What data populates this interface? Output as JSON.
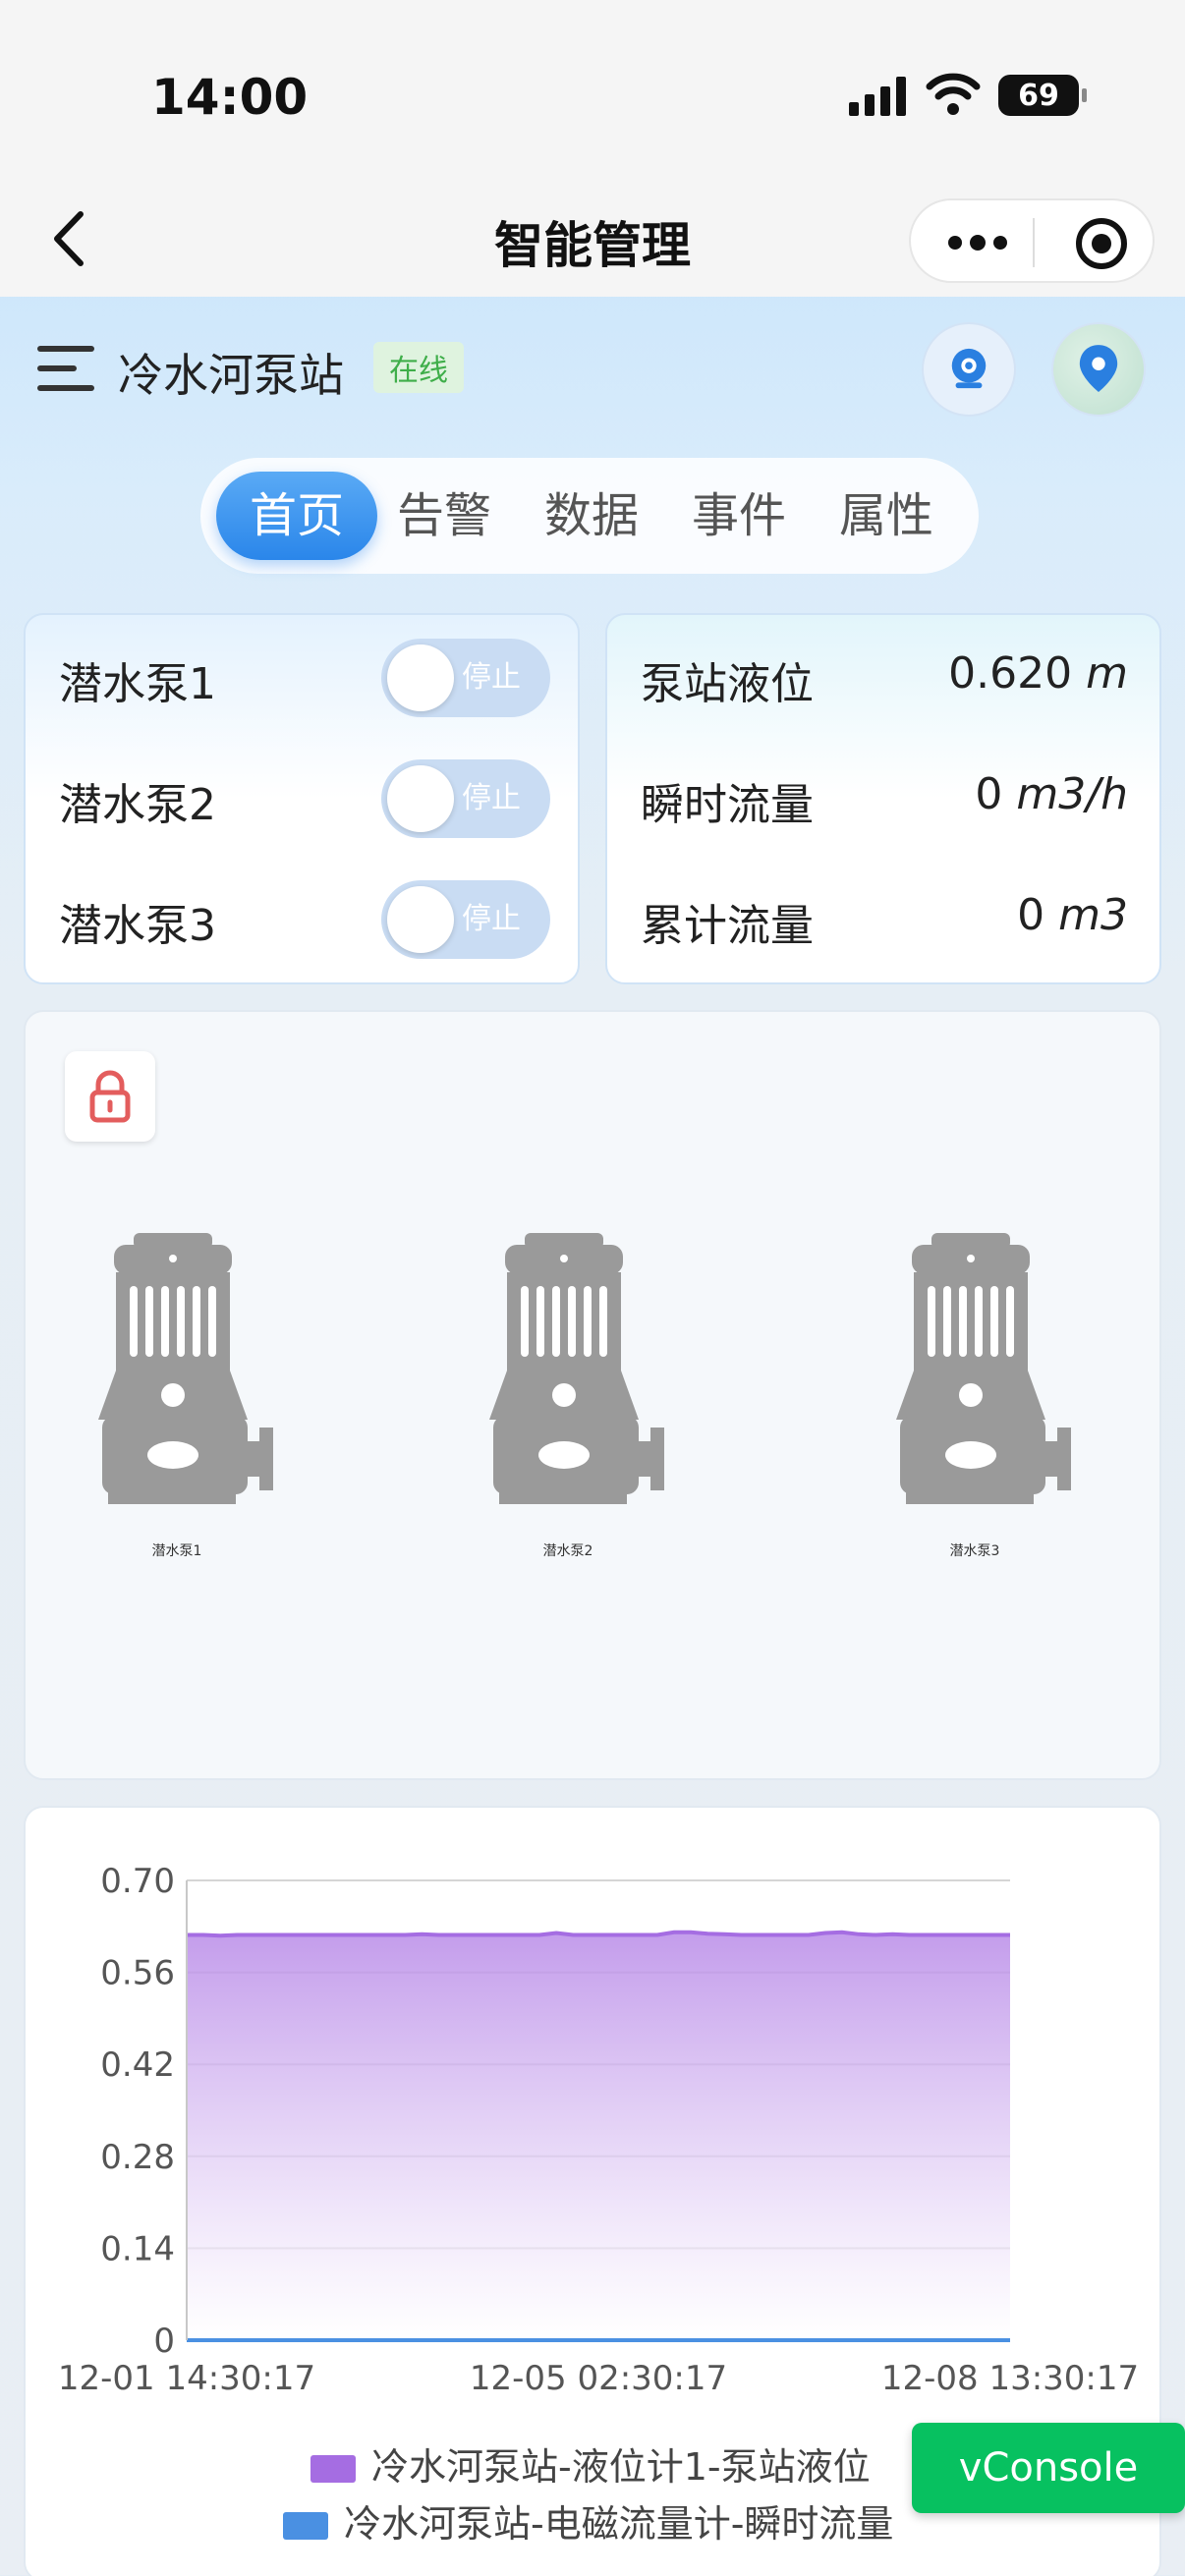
{
  "status_bar": {
    "time": "14:00",
    "battery": "69"
  },
  "navbar": {
    "title": "智能管理"
  },
  "header": {
    "station_name": "冷水河泵站",
    "status_badge": "在线"
  },
  "tabs": [
    {
      "label": "首页",
      "active": true
    },
    {
      "label": "告警",
      "active": false
    },
    {
      "label": "数据",
      "active": false
    },
    {
      "label": "事件",
      "active": false
    },
    {
      "label": "属性",
      "active": false
    }
  ],
  "pumps": [
    {
      "name": "潜水泵1",
      "state": "停止"
    },
    {
      "name": "潜水泵2",
      "state": "停止"
    },
    {
      "name": "潜水泵3",
      "state": "停止"
    }
  ],
  "measurements": [
    {
      "label": "泵站液位",
      "value": "0.620",
      "unit": "m"
    },
    {
      "label": "瞬时流量",
      "value": "0",
      "unit": "m3/h"
    },
    {
      "label": "累计流量",
      "value": "0",
      "unit": "m3"
    }
  ],
  "diagram": {
    "pump_labels": [
      "潜水泵1",
      "潜水泵2",
      "潜水泵3"
    ]
  },
  "chart_data": {
    "type": "area",
    "x_tick_labels": [
      "12-01 14:30:17",
      "12-05 02:30:17",
      "12-08 13:30:17"
    ],
    "y_tick_labels": [
      "0.70",
      "0.56",
      "0.42",
      "0.28",
      "0.14",
      "0"
    ],
    "ylim": [
      0,
      0.7
    ],
    "grid": true,
    "legend_position": "bottom",
    "series": [
      {
        "name": "冷水河泵站-液位计1-泵站液位",
        "color": "#a56de2",
        "values": [
          0.617,
          0.617,
          0.616,
          0.617,
          0.617,
          0.617,
          0.617,
          0.617,
          0.617,
          0.617,
          0.617,
          0.617,
          0.617,
          0.617,
          0.618,
          0.617,
          0.617,
          0.617,
          0.617,
          0.617,
          0.617,
          0.617,
          0.62,
          0.617,
          0.617,
          0.617,
          0.617,
          0.617,
          0.617,
          0.621,
          0.621,
          0.619,
          0.618,
          0.617,
          0.617,
          0.617,
          0.617,
          0.617,
          0.62,
          0.621,
          0.618,
          0.617,
          0.618,
          0.617,
          0.617,
          0.617,
          0.617,
          0.617,
          0.617,
          0.617
        ]
      },
      {
        "name": "冷水河泵站-电磁流量计-瞬时流量",
        "color": "#4a90e2",
        "values": [
          0,
          0,
          0,
          0,
          0,
          0,
          0,
          0,
          0,
          0,
          0,
          0,
          0,
          0,
          0,
          0,
          0,
          0,
          0,
          0,
          0,
          0,
          0,
          0,
          0,
          0,
          0,
          0,
          0,
          0,
          0,
          0,
          0,
          0,
          0,
          0,
          0,
          0,
          0,
          0,
          0,
          0,
          0,
          0,
          0,
          0,
          0,
          0,
          0,
          0
        ]
      }
    ]
  },
  "vconsole": {
    "label": "vConsole"
  },
  "colors": {
    "accent": "#2a86ea",
    "online_green": "#3fae4a",
    "vconsole_green": "#07c160",
    "lock_red": "#e35d5d"
  }
}
